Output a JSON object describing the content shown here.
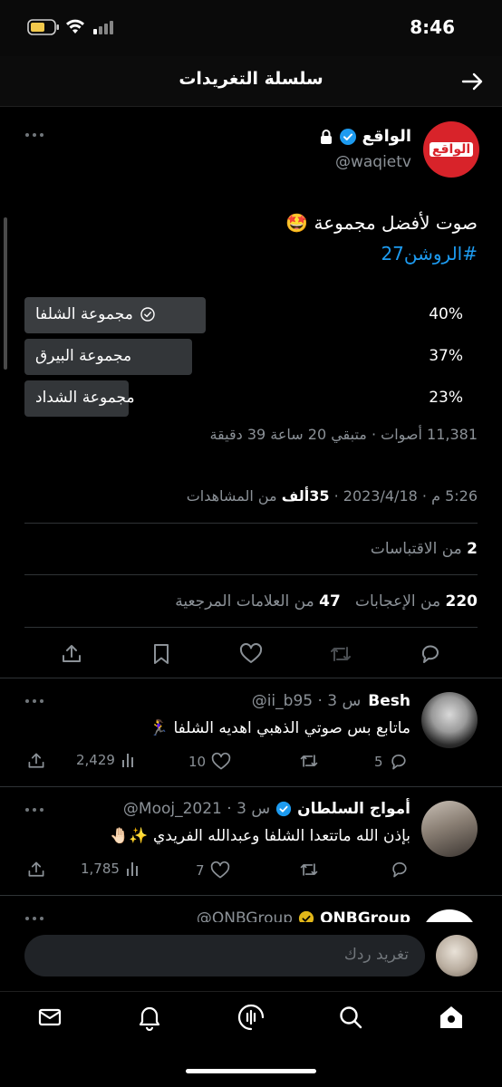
{
  "status_bar": {
    "time": "8:46"
  },
  "header": {
    "title": "سلسلة التغريدات"
  },
  "main_tweet": {
    "avatar_text": "الواقع",
    "display_name": "الواقع",
    "handle": "@waqietv",
    "text": "صوت لأفضل مجموعة 🤩",
    "hashtag": "#الروشن27",
    "poll": {
      "options": [
        {
          "label": "مجموعة الشلفا",
          "percent": "40%",
          "fraction": 0.4,
          "winner": true
        },
        {
          "label": "مجموعة البيرق",
          "percent": "37%",
          "fraction": 0.37,
          "winner": false
        },
        {
          "label": "مجموعة الشداد",
          "percent": "23%",
          "fraction": 0.23,
          "winner": false
        }
      ],
      "meta": "11,381 أصوات · متبقي 20 ساعة 39 دقيقة"
    },
    "timestamp_prefix": "5:26 م · 2023/4/18 · ",
    "views_count": "35ألف",
    "views_label": " من المشاهدات",
    "quotes_count": "2",
    "quotes_label": " من الاقتباسات",
    "likes_count": "220",
    "likes_label": " من الإعجابات",
    "bookmarks_count": "47",
    "bookmarks_label": " من العلامات المرجعية"
  },
  "replies": [
    {
      "name": "Besh",
      "handle_time": "@ii_b95 · 3 س",
      "text": "ماتابع بس صوتي الذهبي اهديه الشلفا 🏃‍♀️",
      "comments": "5",
      "retweets": "",
      "likes": "10",
      "views": "2,429"
    },
    {
      "name": "أمواج السلطان",
      "handle_time": "@Mooj_2021 · 3 س",
      "text": "بإذن الله ماتتعدا الشلفا وعبدالله الفريدي ✨🤚🏻",
      "comments": "",
      "retweets": "",
      "likes": "7",
      "views": "1,785"
    },
    {
      "name": "QNBGroup",
      "handle_time": "@QNBGroup",
      "text": "",
      "comments": "",
      "retweets": "",
      "likes": "",
      "views": ""
    }
  ],
  "composer": {
    "placeholder": "تغريد ردك"
  },
  "colors": {
    "accent": "#1d9bf0",
    "background": "#000000",
    "verified": "#1d9bf0",
    "gold_badge": "#e2b719",
    "brand_red": "#d8232a"
  }
}
